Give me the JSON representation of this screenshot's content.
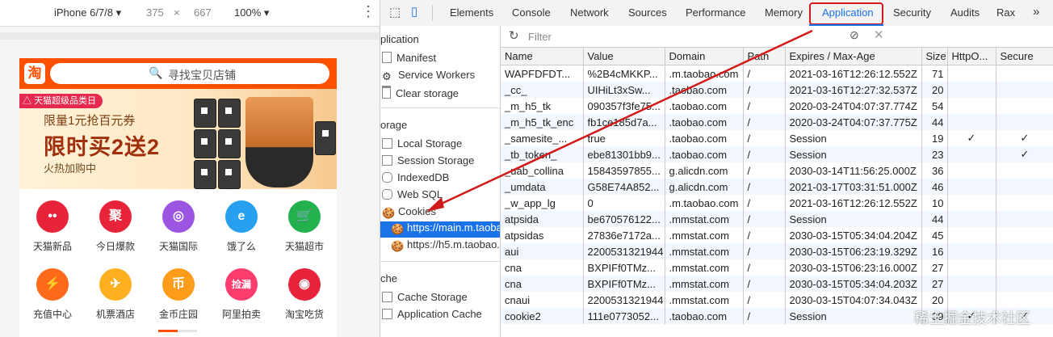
{
  "device_bar": {
    "device": "iPhone 6/7/8",
    "width": "375",
    "times": "×",
    "height": "667",
    "zoom": "100%",
    "more": "⋮"
  },
  "phone": {
    "logo": "淘",
    "search_placeholder": "寻找宝贝店铺",
    "banner": {
      "tag": "天猫超级品类日",
      "line1": "限量1元抢百元券",
      "line2": "限时买2送2",
      "line3": "火热加购中"
    },
    "icons_row1": [
      {
        "label": "天猫新品",
        "glyph": "••",
        "color": "#e8243a"
      },
      {
        "label": "今日爆款",
        "glyph": "聚",
        "color": "#e8243a"
      },
      {
        "label": "天猫国际",
        "glyph": "◎",
        "color": "#9c55e0"
      },
      {
        "label": "饿了么",
        "glyph": "e",
        "color": "#27a0f0"
      },
      {
        "label": "天猫超市",
        "glyph": "🛒",
        "color": "#22b14c"
      }
    ],
    "icons_row2": [
      {
        "label": "充值中心",
        "glyph": "⚡",
        "color": "#ff6a1a"
      },
      {
        "label": "机票酒店",
        "glyph": "✈",
        "color": "#ffb020"
      },
      {
        "label": "金币庄园",
        "glyph": "币",
        "color": "#ff9c1a"
      },
      {
        "label": "阿里拍卖",
        "glyph": "捡漏",
        "color": "#ff3c6e"
      },
      {
        "label": "淘宝吃货",
        "glyph": "◉",
        "color": "#e8243a"
      }
    ]
  },
  "devtools": {
    "tabs": [
      "Elements",
      "Console",
      "Network",
      "Sources",
      "Performance",
      "Memory",
      "Application",
      "Security",
      "Audits",
      "Rax",
      "»"
    ],
    "active_tab": "Application",
    "sidebar": {
      "sec_application": "plication",
      "manifest": "Manifest",
      "service_workers": "Service Workers",
      "clear_storage": "Clear storage",
      "sec_storage": "orage",
      "local_storage": "Local Storage",
      "session_storage": "Session Storage",
      "indexeddb": "IndexedDB",
      "websql": "Web SQL",
      "cookies": "Cookies",
      "cookie_main": "https://main.m.taobao.",
      "cookie_h5": "https://h5.m.taobao.c",
      "sec_cache": "che",
      "cache_storage": "Cache Storage",
      "application_cache": "Application Cache"
    },
    "filter_placeholder": "Filter",
    "columns": [
      "Name",
      "Value",
      "Domain",
      "Path",
      "Expires / Max-Age",
      "Size",
      "HttpO...",
      "Secure"
    ],
    "rows": [
      [
        "WAPFDFDT...",
        "%2B4cMKKP...",
        ".m.taobao.com",
        "/",
        "2021-03-16T12:26:12.552Z",
        "71",
        "",
        ""
      ],
      [
        "_cc_",
        "UIHiLt3xSw...",
        ".taobao.com",
        "/",
        "2021-03-16T12:27:32.537Z",
        "20",
        "",
        ""
      ],
      [
        "_m_h5_tk",
        "090357f3fe75...",
        ".taobao.com",
        "/",
        "2020-03-24T04:07:37.774Z",
        "54",
        "",
        ""
      ],
      [
        "_m_h5_tk_enc",
        "fb1ce185d7a...",
        ".taobao.com",
        "/",
        "2020-03-24T04:07:37.775Z",
        "44",
        "",
        ""
      ],
      [
        "_samesite_...",
        "true",
        ".taobao.com",
        "/",
        "Session",
        "19",
        "✓",
        "✓"
      ],
      [
        "_tb_token_",
        "ebe81301bb9...",
        ".taobao.com",
        "/",
        "Session",
        "23",
        "",
        "✓"
      ],
      [
        "_uab_collina",
        "15843597855...",
        "g.alicdn.com",
        "/",
        "2030-03-14T11:56:25.000Z",
        "36",
        "",
        ""
      ],
      [
        "_umdata",
        "G58E74A852...",
        "g.alicdn.com",
        "/",
        "2021-03-17T03:31:51.000Z",
        "46",
        "",
        ""
      ],
      [
        "_w_app_lg",
        "0",
        ".m.taobao.com",
        "/",
        "2021-03-16T12:26:12.552Z",
        "10",
        "",
        ""
      ],
      [
        "atpsida",
        "be670576122...",
        ".mmstat.com",
        "/",
        "Session",
        "44",
        "",
        ""
      ],
      [
        "atpsidas",
        "27836e7172a...",
        ".mmstat.com",
        "/",
        "2030-03-15T05:34:04.204Z",
        "45",
        "",
        ""
      ],
      [
        "aui",
        "2200531321944",
        ".mmstat.com",
        "/",
        "2030-03-15T06:23:19.329Z",
        "16",
        "",
        ""
      ],
      [
        "cna",
        "BXPIFf0TMz...",
        ".mmstat.com",
        "/",
        "2030-03-15T06:23:16.000Z",
        "27",
        "",
        ""
      ],
      [
        "cna",
        "BXPIFf0TMz...",
        ".mmstat.com",
        "/",
        "2030-03-15T05:34:04.203Z",
        "27",
        "",
        ""
      ],
      [
        "cnaui",
        "2200531321944",
        ".mmstat.com",
        "/",
        "2030-03-15T04:07:34.043Z",
        "20",
        "",
        ""
      ],
      [
        "cookie2",
        "111e0773052...",
        ".taobao.com",
        "/",
        "Session",
        "39",
        "✓",
        "✓"
      ]
    ]
  },
  "watermark": "稀土掘金技术社区",
  "colors": {
    "highlight_box": "#d11a1a",
    "arrow": "#d11a1a",
    "selection": "#1a73e8",
    "taobao_orange": "#ff5000"
  }
}
